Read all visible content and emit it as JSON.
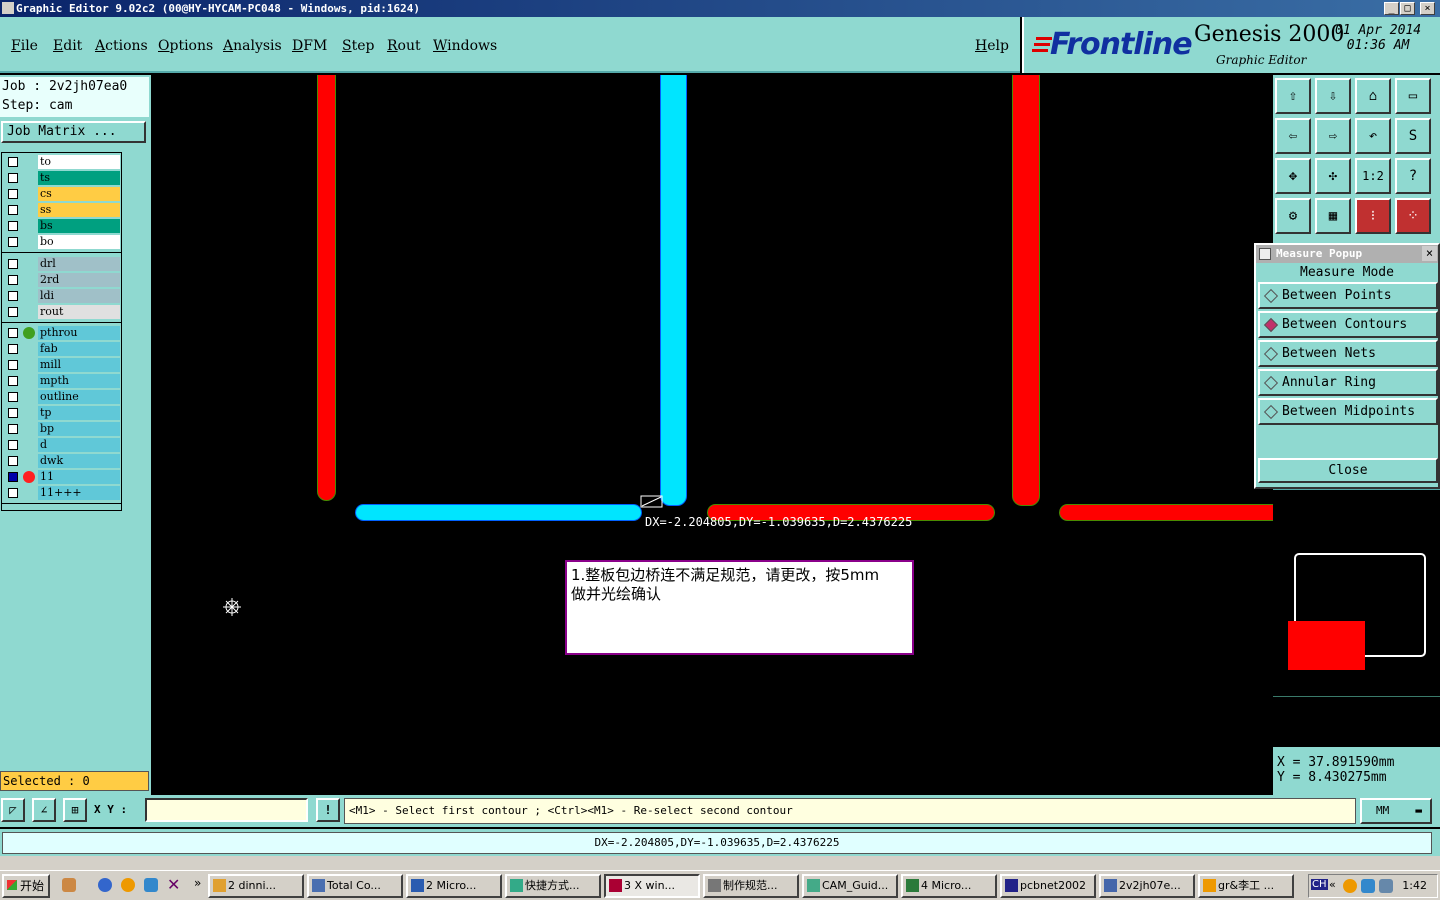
{
  "window": {
    "title": "Graphic Editor 9.02c2 (00@HY-HYCAM-PC048 - Windows, pid:1624)"
  },
  "menu": [
    "File",
    "Edit",
    "Actions",
    "Options",
    "Analysis",
    "DFM",
    "Step",
    "Rout",
    "Windows"
  ],
  "help_label": "Help",
  "brand": {
    "logo": "Frontline",
    "product": "Genesis 2000",
    "subtitle": "Graphic Editor",
    "date": "01 Apr 2014",
    "time": "01:36 AM"
  },
  "job": {
    "job_line": "Job : 2v2jh07ea0",
    "step_line": "Step: cam",
    "matrix_button": "Job Matrix ..."
  },
  "layers": {
    "group1": [
      {
        "name": "to",
        "color": "#ffffff"
      },
      {
        "name": "ts",
        "color": "#00a080"
      },
      {
        "name": "cs",
        "color": "#ffcc44"
      },
      {
        "name": "ss",
        "color": "#ffcc44"
      },
      {
        "name": "bs",
        "color": "#00a080"
      },
      {
        "name": "bo",
        "color": "#ffffff"
      }
    ],
    "group2": [
      {
        "name": "drl",
        "color": "#a0c0c8"
      },
      {
        "name": "2rd",
        "color": "#a0c0c8"
      },
      {
        "name": "ldi",
        "color": "#a0c0c8"
      },
      {
        "name": "rout",
        "color": "#e0e0e0"
      }
    ],
    "group3": [
      {
        "name": "pthrou",
        "color": "#60c8d8"
      },
      {
        "name": "fab",
        "color": "#60c8d8"
      },
      {
        "name": "mill",
        "color": "#60c8d8"
      },
      {
        "name": "mpth",
        "color": "#60c8d8"
      },
      {
        "name": "outline",
        "color": "#60c8d8"
      },
      {
        "name": "tp",
        "color": "#60c8d8"
      },
      {
        "name": "bp",
        "color": "#60c8d8"
      },
      {
        "name": "d",
        "color": "#60c8d8"
      },
      {
        "name": "dwk",
        "color": "#60c8d8"
      },
      {
        "name": "11",
        "color": "#60c8d8"
      },
      {
        "name": "11+++",
        "color": "#60c8d8"
      }
    ]
  },
  "selected_label": "Selected : 0",
  "measurement_text": "DX=-2.204805,DY=-1.039635,D=2.4376225",
  "note": {
    "line1": "1.整板包边桥连不满足规范，请更改，按5mm",
    "line2": "做并光绘确认"
  },
  "popup": {
    "title": "Measure Popup",
    "mode_label": "Measure Mode",
    "options": [
      "Between Points",
      "Between Contours",
      "Between Nets",
      "Annular Ring",
      "Between Midpoints"
    ],
    "selected_option": "Between Contours",
    "close_label": "Close"
  },
  "coords": {
    "x": "X  =  37.891590mm",
    "y": "Y  =  8.430275mm"
  },
  "command": {
    "xy_label": "X Y :",
    "prompt": "<M1> - Select first contour ; <Ctrl><M1> - Re-select second contour",
    "units": "MM",
    "status": "DX=-2.204805,DY=-1.039635,D=2.4376225"
  },
  "taskbar": {
    "start": "开始",
    "tasks": [
      "2 dinni...",
      "Total Co...",
      "2 Micro...",
      "快捷方式...",
      "3 X win...",
      "制作规范...",
      "CAM_Guid...",
      "4 Micro...",
      "pcbnet2002",
      "2v2jh07e...",
      "gr&李工 ..."
    ],
    "clock": "1:42",
    "tray_label": "CH"
  },
  "colors": {
    "panel": "#8fd9d0",
    "canvas": "#000000",
    "trace_red": "#ff0000",
    "trace_cyan": "#00e5ff"
  }
}
